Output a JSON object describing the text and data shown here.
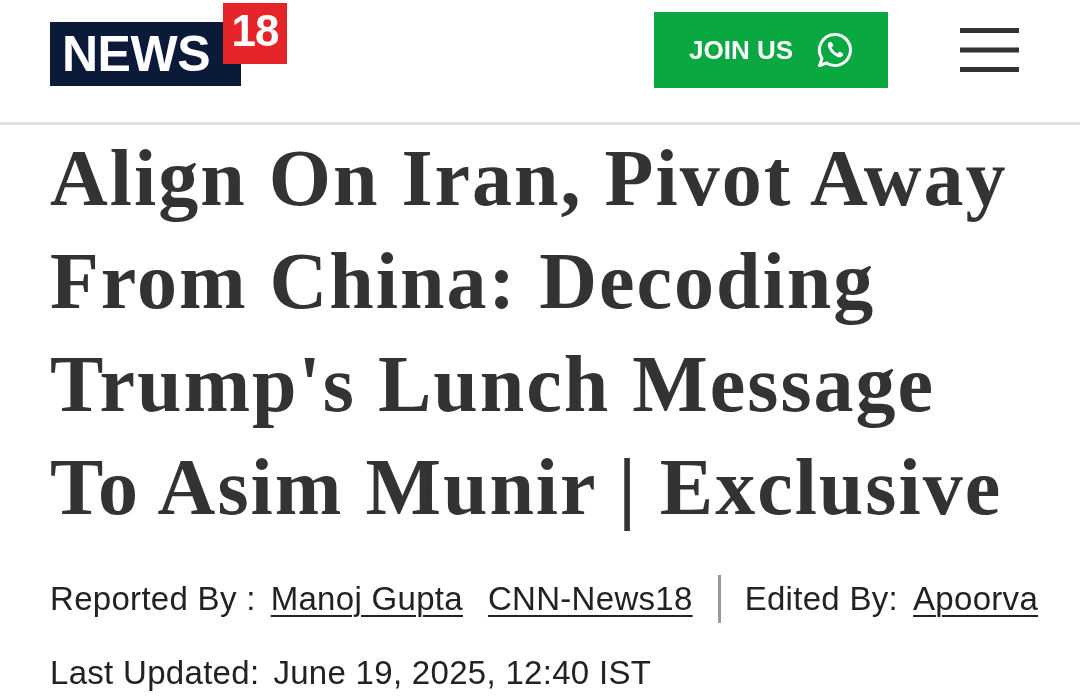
{
  "header": {
    "logo": {
      "word": "NEWS",
      "number": "18"
    },
    "join_button": {
      "label": "JOIN US"
    }
  },
  "article": {
    "headline": "Align On Iran, Pivot Away From China: Decoding Trump's Lunch Message To Asim Munir | Exclusive",
    "byline": {
      "reported_label": "Reported By :",
      "reporters": [
        "Manoj Gupta",
        "CNN-News18"
      ],
      "edited_label": "Edited By:",
      "editors": [
        "Apoorva"
      ]
    },
    "updated": {
      "label": "Last Updated:",
      "value": "June 19, 2025, 12:40 IST"
    }
  }
}
